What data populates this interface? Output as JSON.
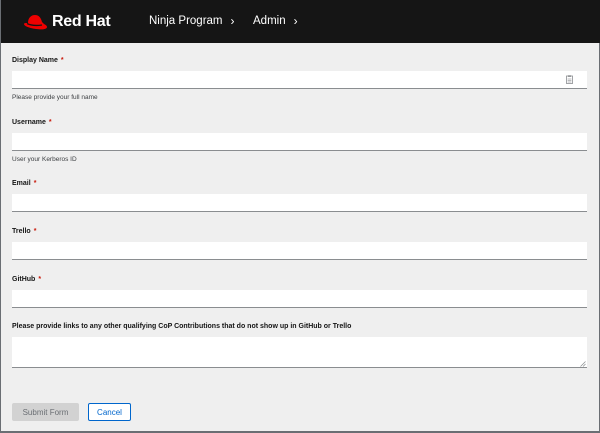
{
  "header": {
    "brand": "Red Hat",
    "nav": [
      {
        "label": "Ninja Program"
      },
      {
        "label": "Admin"
      }
    ]
  },
  "form": {
    "required_marker": "*",
    "display_name": {
      "label": "Display Name",
      "value": "",
      "helper": "Please provide your full name"
    },
    "username": {
      "label": "Username",
      "value": "",
      "helper": "User your Kerberos ID"
    },
    "email": {
      "label": "Email",
      "value": ""
    },
    "trello": {
      "label": "Trello",
      "value": ""
    },
    "github": {
      "label": "GitHub",
      "value": ""
    },
    "contributions": {
      "label": "Please provide links to any other qualifying CoP Contributions that do not show up in GitHub or Trello",
      "value": ""
    },
    "submit_label": "Submit Form",
    "cancel_label": "Cancel"
  },
  "colors": {
    "header_bg": "#151515",
    "page_bg": "#efefef",
    "brand_red": "#ee0000",
    "required_red": "#c9190b",
    "link_blue": "#0066cc"
  },
  "icons": {
    "logo": "red-hat-fedora-icon",
    "nav_chevron": "chevron-right-icon",
    "field_icon": "clipboard-icon"
  }
}
